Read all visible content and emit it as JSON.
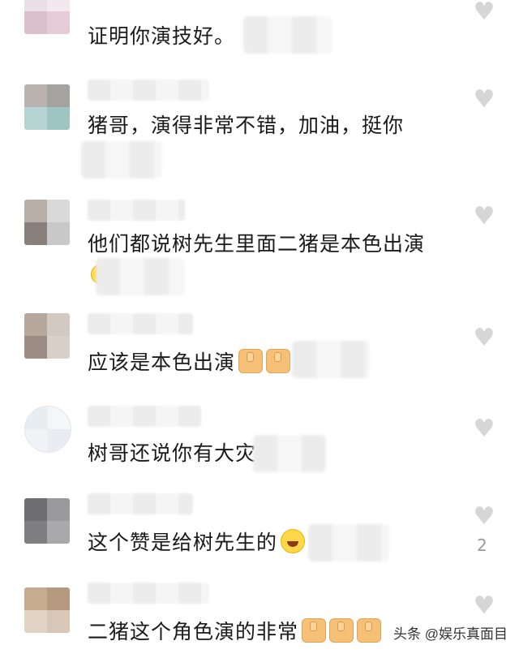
{
  "comments": [
    {
      "text": "证明你演技好。"
    },
    {
      "text": "猪哥，演得非常不错，加油，挺你"
    },
    {
      "text": "他们都说树先生里面二猪是本色出演"
    },
    {
      "text": "应该是本色出演"
    },
    {
      "text": "树哥还说你有大灾"
    },
    {
      "text": "这个赞是给树先生的",
      "likes": "2"
    },
    {
      "text": "二猪这个角色演的非常"
    }
  ],
  "icons": {
    "like": "heart-icon",
    "thumbs_up": "thumbs-up-emoji",
    "laugh": "laughing-emoji"
  },
  "watermark": "头条 @娱乐真面目",
  "colors": {
    "background": "#ffffff",
    "text": "#1a1a1a",
    "like_icon": "#d6d6d6",
    "like_count": "#999999"
  }
}
